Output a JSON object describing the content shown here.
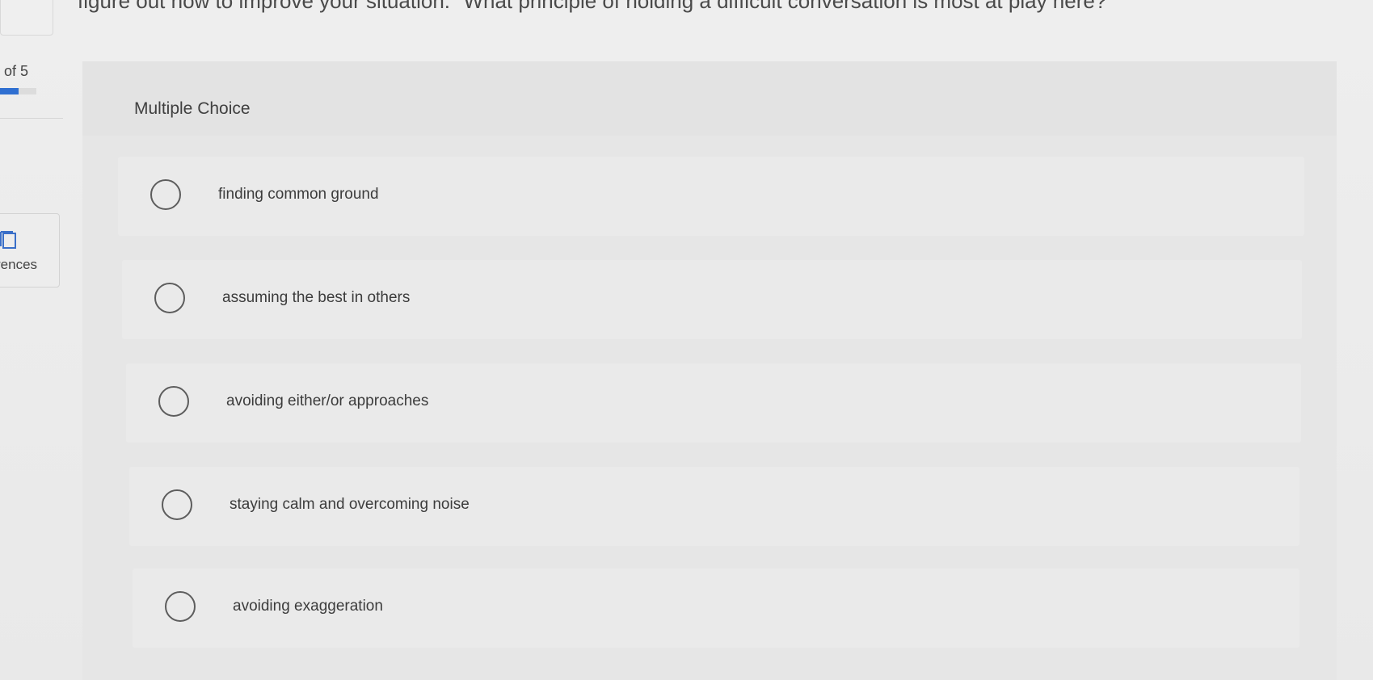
{
  "question": {
    "text": "figure out how to improve your situation.\" What principle of holding a difficult conversation is most at play here?"
  },
  "progress": {
    "label": "of 5",
    "fraction": 0.5
  },
  "sidebar": {
    "references_label": "rences",
    "references_icon": "book-icon"
  },
  "card": {
    "title": "Multiple Choice"
  },
  "options": [
    {
      "label": "finding common ground"
    },
    {
      "label": "assuming the best in others"
    },
    {
      "label": "avoiding either/or approaches"
    },
    {
      "label": "staying calm and overcoming noise"
    },
    {
      "label": "avoiding exaggeration"
    }
  ],
  "colors": {
    "accent": "#2f6fd1",
    "background": "#ececec",
    "radio_border": "#5d5d5d"
  }
}
